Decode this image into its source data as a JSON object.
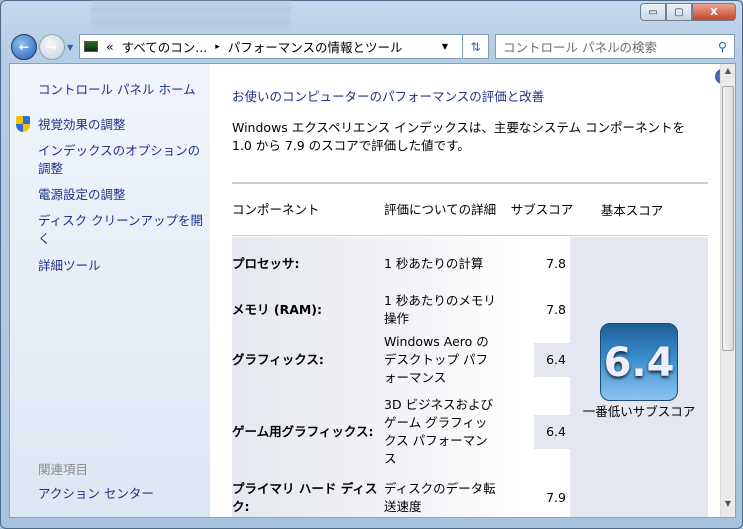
{
  "window": {
    "minimize": "▭",
    "maximize": "▢",
    "close": "X"
  },
  "address": {
    "overflow": "«",
    "crumbs": [
      "すべてのコン...",
      "パフォーマンスの情報とツール"
    ],
    "sep": "▸"
  },
  "search": {
    "placeholder": "コントロール パネルの検索"
  },
  "sidebar": {
    "home": "コントロール パネル ホーム",
    "items": [
      {
        "label": "視覚効果の調整",
        "icon": "uac-shield-icon"
      },
      {
        "label": "インデックスのオプションの調整"
      },
      {
        "label": "電源設定の調整"
      },
      {
        "label": "ディスク クリーンアップを開く"
      },
      {
        "label": "詳細ツール"
      }
    ],
    "related_heading": "関連項目",
    "related": [
      "アクション センター"
    ]
  },
  "main": {
    "help": "?",
    "title": "お使いのコンピューターのパフォーマンスの評価と改善",
    "description": "Windows エクスペリエンス インデックスは、主要なシステム コンポーネントを 1.0 から 7.9 のスコアで評価した値です。",
    "table": {
      "headers": [
        "コンポーネント",
        "評価についての詳細",
        "サブスコア",
        "基本スコア"
      ],
      "rows": [
        {
          "component": "プロセッサ:",
          "detail": "1 秒あたりの計算",
          "subscore": "7.8"
        },
        {
          "component": "メモリ (RAM):",
          "detail": "1 秒あたりのメモリ操作",
          "subscore": "7.8"
        },
        {
          "component": "グラフィックス:",
          "detail": "Windows Aero のデスクトップ パフォーマンス",
          "subscore": "6.4"
        },
        {
          "component": "ゲーム用グラフィックス:",
          "detail": "3D ビジネスおよびゲーム グラフィックス パフォーマンス",
          "subscore": "6.4"
        },
        {
          "component": "プライマリ ハード ディスク:",
          "detail": "ディスクのデータ転送速度",
          "subscore": "7.9"
        }
      ],
      "base_score": "6.4",
      "base_score_label": "一番低いサブスコア"
    }
  }
}
